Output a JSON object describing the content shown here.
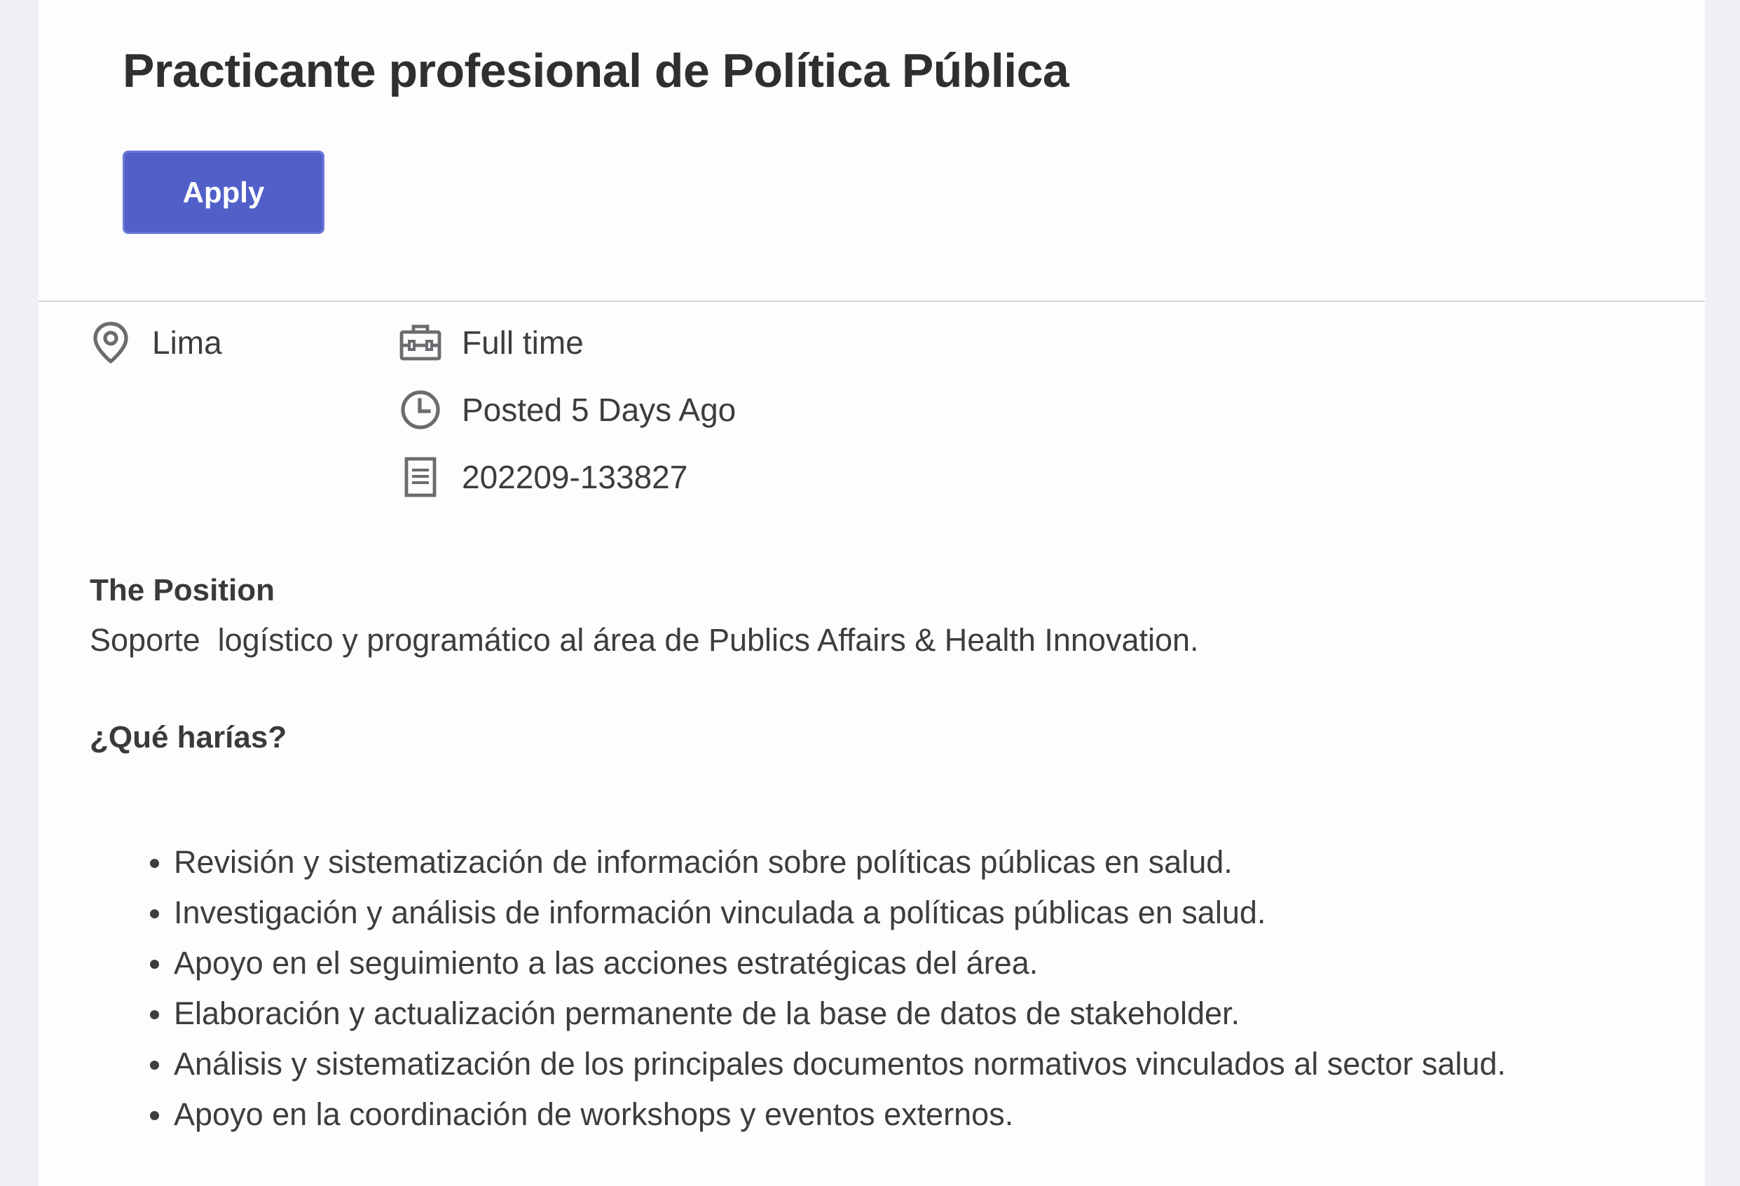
{
  "job": {
    "title": "Practicante profesional de Política Pública",
    "apply_label": "Apply"
  },
  "meta": {
    "location": "Lima",
    "job_type": "Full time",
    "posted": "Posted 5 Days Ago",
    "requisition_id": "202209-133827"
  },
  "description": {
    "position_heading": "The Position",
    "position_text": "Soporte  logístico y programático al área de Publics Affairs & Health Innovation.",
    "duties_heading": "¿Qué harías?",
    "duties": [
      "Revisión y sistematización de información sobre políticas públicas en salud.",
      "Investigación y análisis de información vinculada a políticas públicas en salud.",
      "Apoyo en el seguimiento a las acciones estratégicas del área.",
      "Elaboración y actualización permanente de la base de datos de stakeholder.",
      "Análisis y sistematización de los principales documentos normativos vinculados al sector salud.",
      "Apoyo en la coordinación de workshops y eventos externos."
    ]
  },
  "colors": {
    "accent": "#5160c8",
    "background": "#eff0f3",
    "card": "#fdfdfd",
    "icon": "#6b6b70"
  },
  "icons": {
    "location": "location-pin-icon",
    "job_type": "briefcase-icon",
    "posted": "clock-icon",
    "requisition": "document-icon"
  }
}
